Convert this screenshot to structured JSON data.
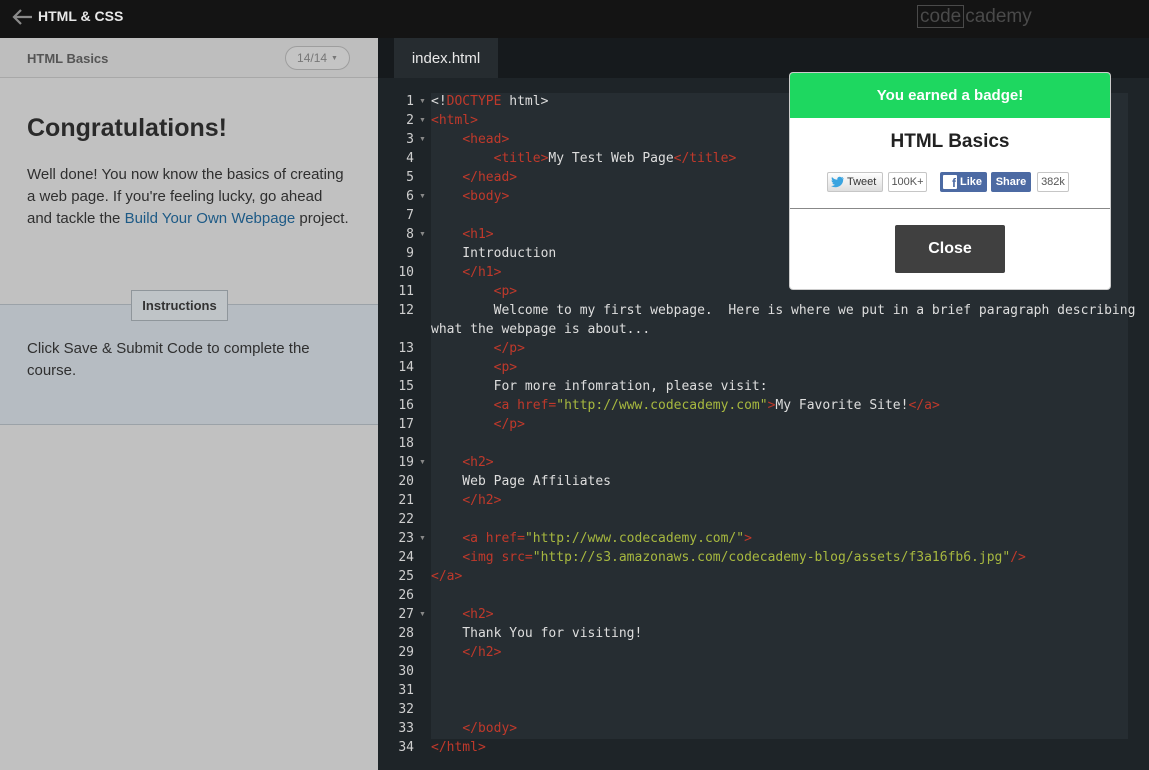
{
  "topbar": {
    "course_title": "HTML & CSS",
    "logo_box_text": "code",
    "logo_rest_text": "cademy"
  },
  "lesson": {
    "section_title": "HTML Basics",
    "pager": "14/14",
    "heading": "Congratulations!",
    "paragraph_before_link": "Well done! You now know the basics of creating a web page. If you're feeling lucky, go ahead and tackle the ",
    "link_text": "Build Your Own Webpage",
    "paragraph_after_link": " project.",
    "instructions_tab": "Instructions",
    "instructions_text": "Click Save & Submit Code to complete the course."
  },
  "editor": {
    "tab_label": "index.html",
    "folded_lines": [
      1,
      2,
      3,
      6,
      8,
      19,
      23,
      27
    ],
    "lines": [
      {
        "n": "1",
        "parts": [
          [
            "p",
            "<!"
          ],
          [
            "t",
            "DOCTYPE"
          ],
          [
            "p",
            " html>"
          ]
        ]
      },
      {
        "n": "2",
        "parts": [
          [
            "t",
            "<html>"
          ]
        ]
      },
      {
        "n": "3",
        "parts": [
          [
            "p",
            "    "
          ],
          [
            "t",
            "<head>"
          ]
        ]
      },
      {
        "n": "4",
        "parts": [
          [
            "p",
            "        "
          ],
          [
            "t",
            "<title>"
          ],
          [
            "p",
            "My Test Web Page"
          ],
          [
            "t",
            "</title>"
          ]
        ]
      },
      {
        "n": "5",
        "parts": [
          [
            "p",
            "    "
          ],
          [
            "t",
            "</head>"
          ]
        ]
      },
      {
        "n": "6",
        "parts": [
          [
            "p",
            "    "
          ],
          [
            "t",
            "<body>"
          ]
        ]
      },
      {
        "n": "7",
        "parts": []
      },
      {
        "n": "8",
        "parts": [
          [
            "p",
            "    "
          ],
          [
            "t",
            "<h1>"
          ]
        ]
      },
      {
        "n": "9",
        "parts": [
          [
            "p",
            "    Introduction"
          ]
        ]
      },
      {
        "n": "10",
        "parts": [
          [
            "p",
            "    "
          ],
          [
            "t",
            "</h1>"
          ]
        ]
      },
      {
        "n": "11",
        "parts": [
          [
            "p",
            "        "
          ],
          [
            "t",
            "<p>"
          ]
        ]
      },
      {
        "n": "12",
        "parts": [
          [
            "p",
            "        Welcome to my first webpage.  Here is where we put in a brief paragraph describing"
          ]
        ]
      },
      {
        "n": "",
        "parts": [
          [
            "p",
            "what the webpage is about..."
          ]
        ]
      },
      {
        "n": "13",
        "parts": [
          [
            "p",
            "        "
          ],
          [
            "t",
            "</p>"
          ]
        ]
      },
      {
        "n": "14",
        "parts": [
          [
            "p",
            "        "
          ],
          [
            "t",
            "<p>"
          ]
        ]
      },
      {
        "n": "15",
        "parts": [
          [
            "p",
            "        For more infomration, please visit:"
          ]
        ]
      },
      {
        "n": "16",
        "parts": [
          [
            "p",
            "        "
          ],
          [
            "t",
            "<a "
          ],
          [
            "an",
            "href="
          ],
          [
            "av",
            "\"http://www.codecademy.com\""
          ],
          [
            "t",
            ">"
          ],
          [
            "p",
            "My Favorite Site!"
          ],
          [
            "t",
            "</a>"
          ]
        ]
      },
      {
        "n": "17",
        "parts": [
          [
            "p",
            "        "
          ],
          [
            "t",
            "</p>"
          ]
        ]
      },
      {
        "n": "18",
        "parts": []
      },
      {
        "n": "19",
        "parts": [
          [
            "p",
            "    "
          ],
          [
            "t",
            "<h2>"
          ]
        ]
      },
      {
        "n": "20",
        "parts": [
          [
            "p",
            "    Web Page Affiliates"
          ]
        ]
      },
      {
        "n": "21",
        "parts": [
          [
            "p",
            "    "
          ],
          [
            "t",
            "</h2>"
          ]
        ]
      },
      {
        "n": "22",
        "parts": []
      },
      {
        "n": "23",
        "parts": [
          [
            "p",
            "    "
          ],
          [
            "t",
            "<a "
          ],
          [
            "an",
            "href="
          ],
          [
            "av",
            "\"http://www.codecademy.com/\""
          ],
          [
            "t",
            ">"
          ]
        ]
      },
      {
        "n": "24",
        "parts": [
          [
            "p",
            "    "
          ],
          [
            "t",
            "<img "
          ],
          [
            "an",
            "src="
          ],
          [
            "av",
            "\"http://s3.amazonaws.com/codecademy-blog/assets/f3a16fb6.jpg\""
          ],
          [
            "t",
            "/>"
          ]
        ]
      },
      {
        "n": "25",
        "parts": [
          [
            "t",
            "</a>"
          ]
        ]
      },
      {
        "n": "26",
        "parts": []
      },
      {
        "n": "27",
        "parts": [
          [
            "p",
            "    "
          ],
          [
            "t",
            "<h2>"
          ]
        ]
      },
      {
        "n": "28",
        "parts": [
          [
            "p",
            "    Thank You for visiting!"
          ]
        ]
      },
      {
        "n": "29",
        "parts": [
          [
            "p",
            "    "
          ],
          [
            "t",
            "</h2>"
          ]
        ]
      },
      {
        "n": "30",
        "parts": []
      },
      {
        "n": "31",
        "parts": []
      },
      {
        "n": "32",
        "parts": []
      },
      {
        "n": "33",
        "parts": [
          [
            "p",
            "    "
          ],
          [
            "t",
            "</body>"
          ]
        ]
      },
      {
        "n": "34",
        "parts": [
          [
            "t",
            "</html>"
          ]
        ]
      }
    ]
  },
  "badge_modal": {
    "banner": "You earned a badge!",
    "title": "HTML Basics",
    "tweet_label": "Tweet",
    "tweet_count": "100K+",
    "like_label": "Like",
    "share_label": "Share",
    "share_count": "382k",
    "close_label": "Close",
    "banner_color": "#1ed760"
  }
}
